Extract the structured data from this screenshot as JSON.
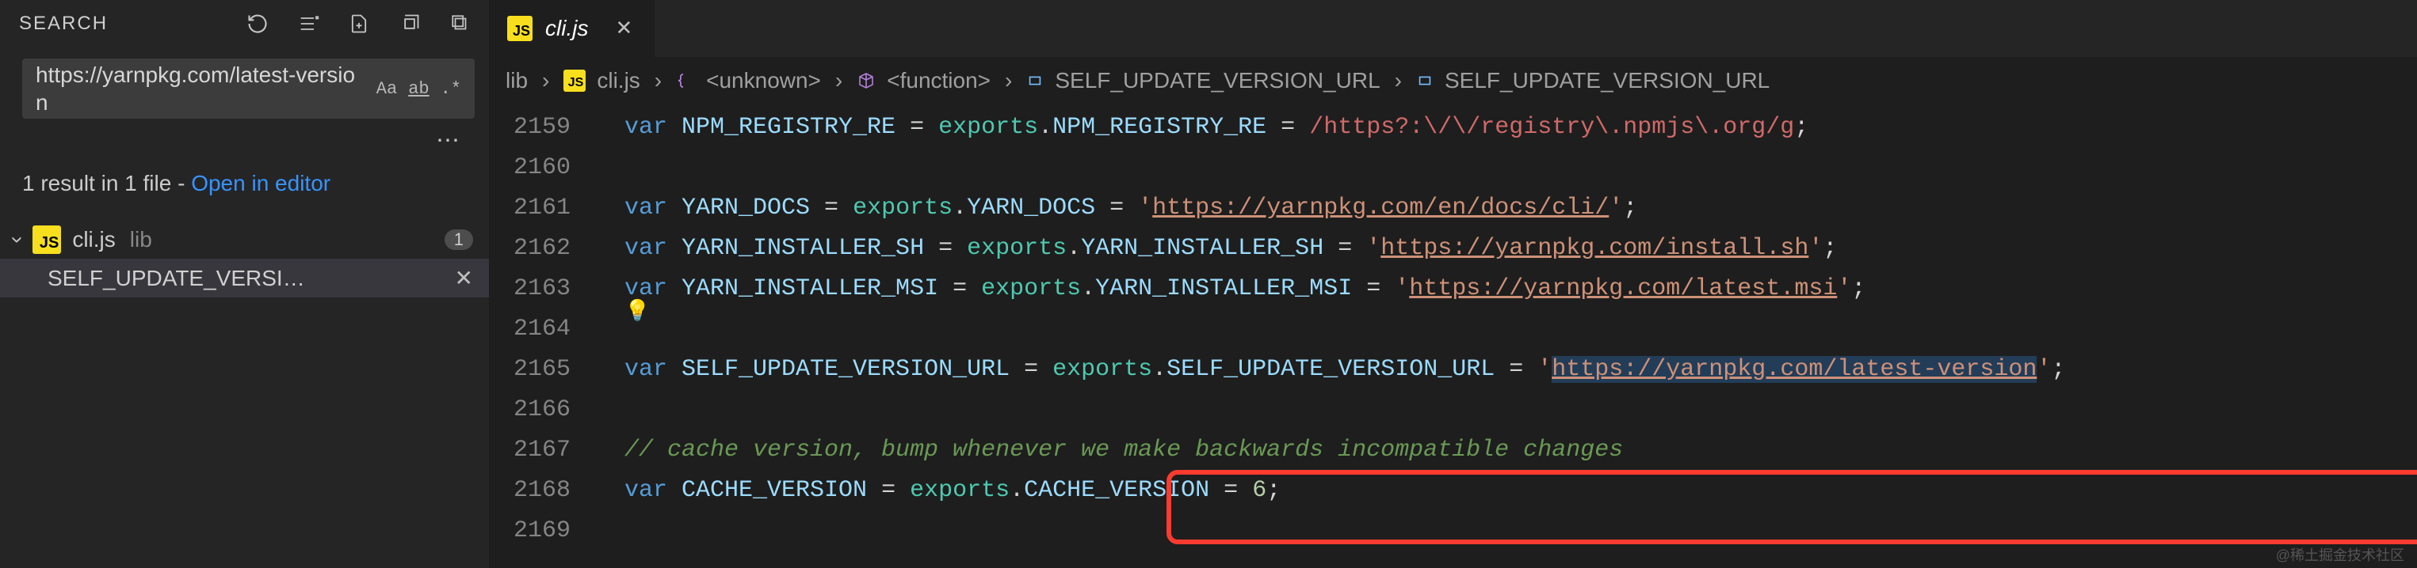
{
  "sidebar": {
    "title": "SEARCH",
    "query": "https://yarnpkg.com/latest-version",
    "opts": {
      "case": "Aa",
      "word": "ab",
      "regex": ".*"
    },
    "summary_prefix": "1 result in 1 file - ",
    "summary_link": "Open in editor",
    "file": {
      "name": "cli.js",
      "folder": "lib",
      "count": "1"
    },
    "match": "SELF_UPDATE_VERSI…"
  },
  "tab": {
    "file": "cli.js",
    "badge": "JS"
  },
  "breadcrumbs": {
    "folder": "lib",
    "file": "cli.js",
    "seg1": "<unknown>",
    "seg2": "<function>",
    "seg3": "SELF_UPDATE_VERSION_URL",
    "seg4": "SELF_UPDATE_VERSION_URL"
  },
  "lines": {
    "n": [
      "2159",
      "2160",
      "2161",
      "2162",
      "2163",
      "2164",
      "2165",
      "2166",
      "2167",
      "2168",
      "2169"
    ]
  },
  "code": {
    "l2159": {
      "a": "var ",
      "b": "NPM_REGISTRY_RE",
      "c": " = ",
      "d": "exports",
      "e": ".",
      "f": "NPM_REGISTRY_RE",
      "g": " = ",
      "h": "/https?:\\/\\/registry\\.npmjs\\.org/g",
      "i": ";"
    },
    "l2161": {
      "a": "var ",
      "b": "YARN_DOCS",
      "c": " = ",
      "d": "exports",
      "e": ".",
      "f": "YARN_DOCS",
      "g": " = ",
      "h": "'",
      "i": "https://yarnpkg.com/en/docs/cli/",
      "j": "'",
      "k": ";"
    },
    "l2162": {
      "a": "var ",
      "b": "YARN_INSTALLER_SH",
      "c": " = ",
      "d": "exports",
      "e": ".",
      "f": "YARN_INSTALLER_SH",
      "g": " = ",
      "h": "'",
      "i": "https://yarnpkg.com/install.sh",
      "j": "'",
      "k": ";"
    },
    "l2163": {
      "a": "var ",
      "b": "YARN_INSTALLER_MSI",
      "c": " = ",
      "d": "exports",
      "e": ".",
      "f": "YARN_INSTALLER_MSI",
      "g": " = ",
      "h": "'",
      "i": "https://yarnpkg.com/latest.msi",
      "j": "'",
      "k": ";"
    },
    "l2165": {
      "a": "var ",
      "b": "SELF_UPDATE_VERSION_URL",
      "c": " = ",
      "d": "exports",
      "e": ".",
      "f": "SELF_UPDATE_VERSION_URL",
      "g": " = ",
      "h": "'",
      "i": "https://yarnpkg.com/latest-version",
      "j": "'",
      "k": ";"
    },
    "l2167": "// cache version, bump whenever we make backwards incompatible changes",
    "l2168": {
      "a": "var ",
      "b": "CACHE_VERSION",
      "c": " = ",
      "d": "exports",
      "e": ".",
      "f": "CACHE_VERSION",
      "g": " = ",
      "h": "6",
      "i": ";"
    }
  },
  "watermark": "@稀土掘金技术社区"
}
